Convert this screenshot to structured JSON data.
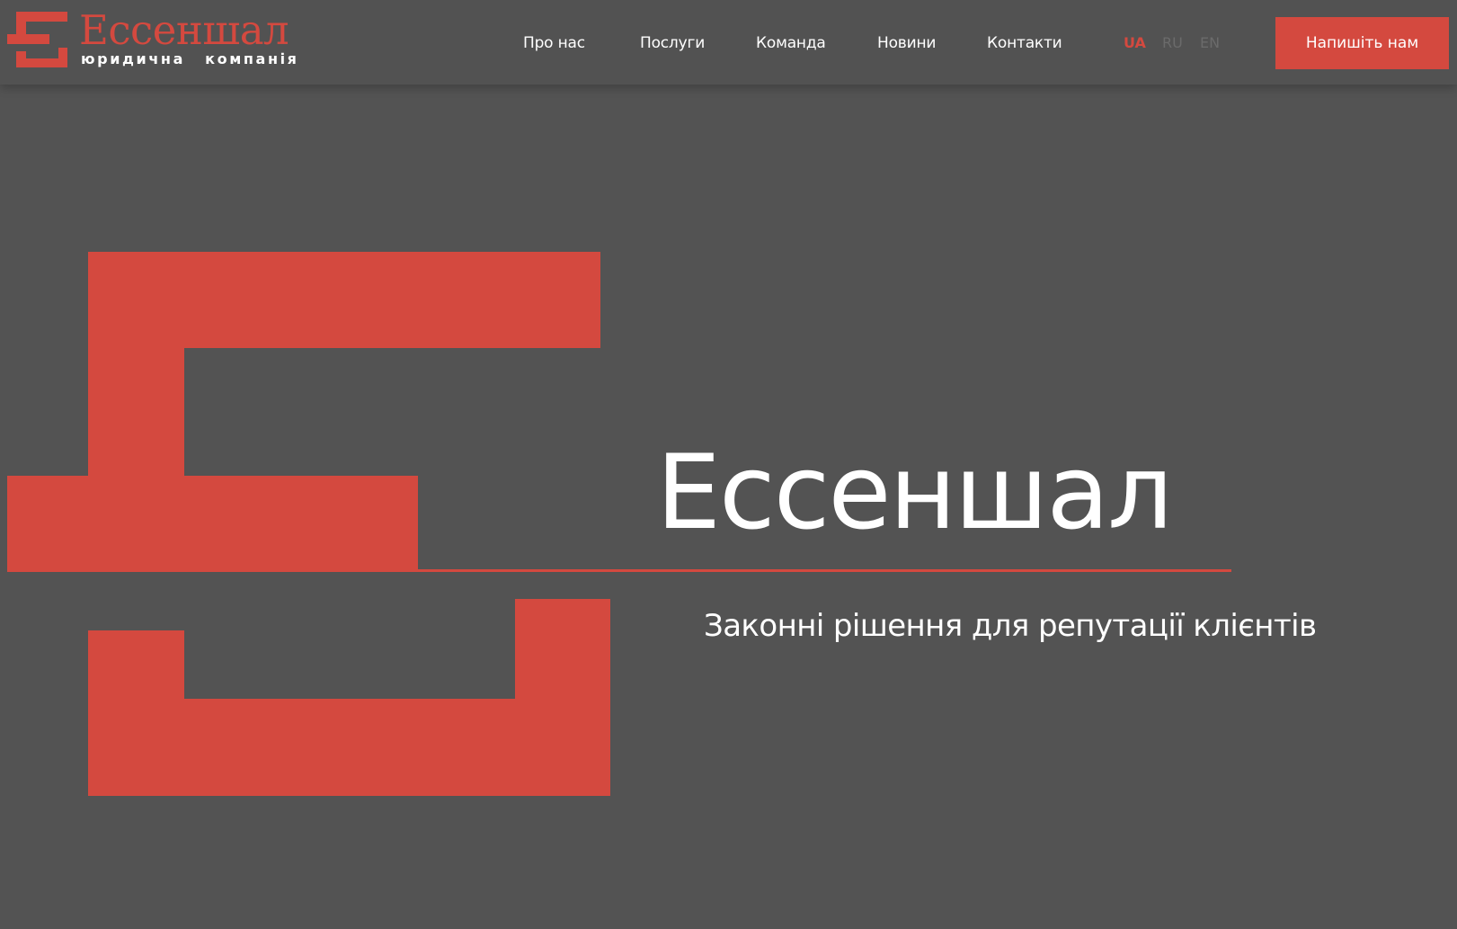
{
  "brand": {
    "name": "Ессеншал",
    "tagline": "юридична компанія",
    "accent_color": "#d4493f",
    "background_color": "#535353"
  },
  "nav": {
    "items": [
      {
        "label": "Про нас"
      },
      {
        "label": "Послуги"
      },
      {
        "label": "Команда"
      },
      {
        "label": "Новини"
      },
      {
        "label": "Контакти"
      }
    ]
  },
  "languages": {
    "items": [
      {
        "label": "UA",
        "active": true
      },
      {
        "label": "RU",
        "active": false
      },
      {
        "label": "EN",
        "active": false
      }
    ]
  },
  "header": {
    "cta_label": "Напишіть нам"
  },
  "hero": {
    "title": "Ессеншал",
    "subtitle": "Законні рішення для репутації клієнтів"
  }
}
